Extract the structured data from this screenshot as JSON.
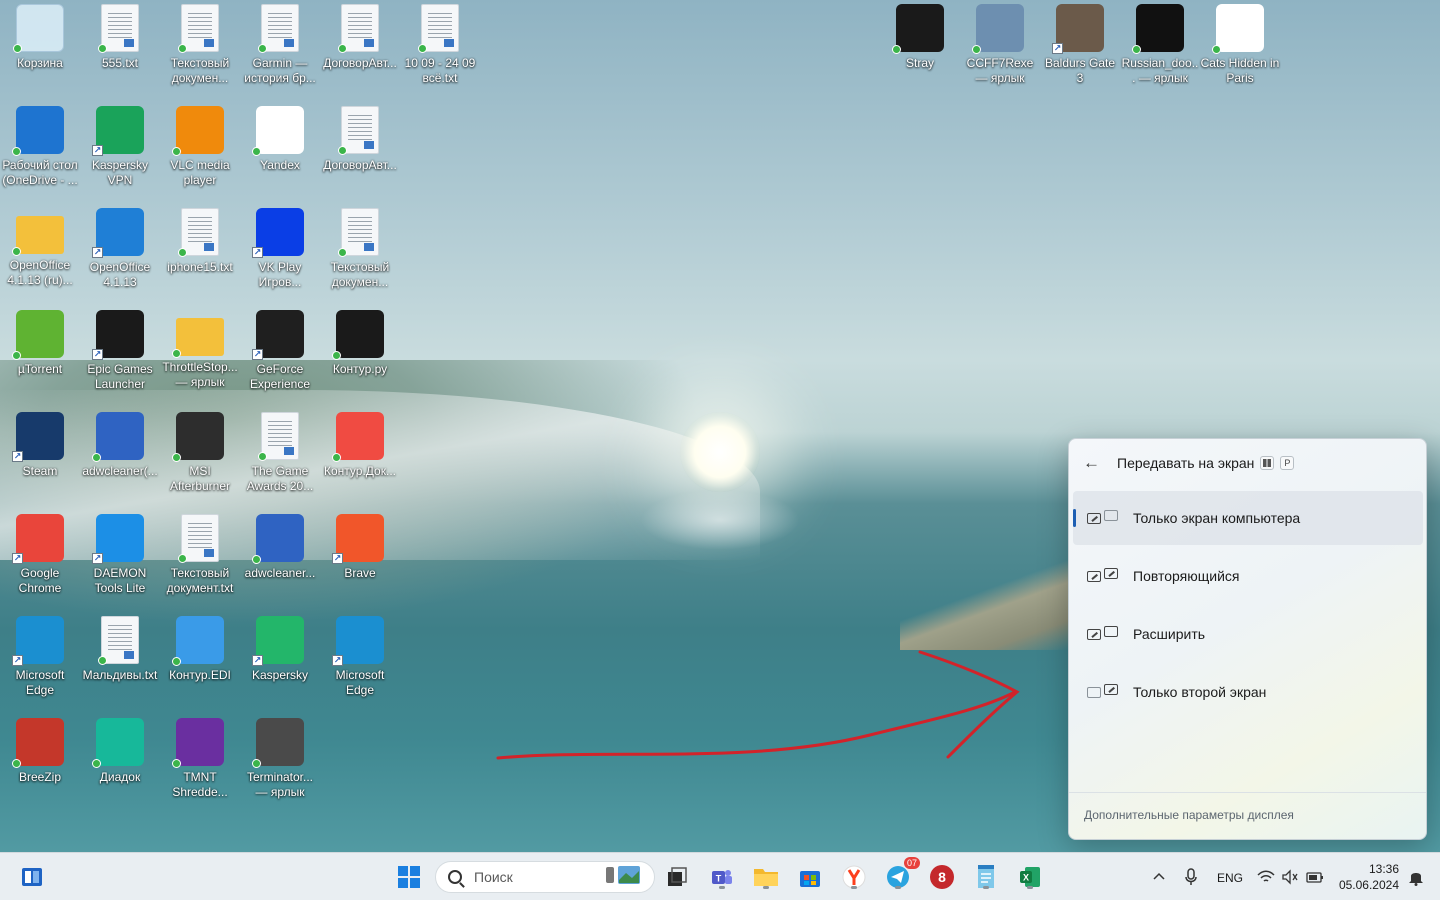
{
  "desktop": {
    "icons": [
      {
        "label": "Корзина",
        "icon": "recycle-bin-icon",
        "color": "#cfe6f5"
      },
      {
        "label": "555.txt",
        "icon": "text-file-icon"
      },
      {
        "label": "Текстовый докумен...",
        "icon": "text-file-icon"
      },
      {
        "label": "Garmin — история бр...",
        "icon": "text-file-icon"
      },
      {
        "label": "ДоговорАвт...",
        "icon": "document-icon"
      },
      {
        "label": "10 09 - 24 09 всё.txt",
        "icon": "text-file-icon"
      },
      {
        "label": "Рабочий стол (OneDrive - ...",
        "icon": "onedrive-icon",
        "color": "#1e74d0"
      },
      {
        "label": "Kaspersky VPN",
        "icon": "kaspersky-vpn-icon",
        "color": "#1aa35a"
      },
      {
        "label": "VLC media player",
        "icon": "vlc-icon",
        "color": "#f08a0c"
      },
      {
        "label": "Yandex",
        "icon": "yandex-browser-icon",
        "color": "#ffffff"
      },
      {
        "label": "ДоговорАвт...",
        "icon": "document-icon"
      },
      {
        "label": "OpenOffice 4.1.13 (ru)...",
        "icon": "folder-icon",
        "color": "#f3c03b"
      },
      {
        "label": "OpenOffice 4.1.13",
        "icon": "openoffice-icon",
        "color": "#1f7fd6"
      },
      {
        "label": "iphone15.txt",
        "icon": "text-file-icon"
      },
      {
        "label": "VK Play Игров...",
        "icon": "vk-play-icon",
        "color": "#0a3ee6"
      },
      {
        "label": "Текстовый докумен...",
        "icon": "text-file-icon"
      },
      {
        "label": "µTorrent",
        "icon": "utorrent-icon",
        "color": "#5fb332"
      },
      {
        "label": "Epic Games Launcher",
        "icon": "epic-games-icon",
        "color": "#1a1a1a"
      },
      {
        "label": "ThrottleStop... — ярлык",
        "icon": "folder-icon",
        "color": "#f3c03b"
      },
      {
        "label": "GeForce Experience",
        "icon": "geforce-icon",
        "color": "#1f1f1f"
      },
      {
        "label": "Контур.ру",
        "icon": "kontur-icon",
        "color": "#1a1a1a"
      },
      {
        "label": "Steam",
        "icon": "steam-icon",
        "color": "#173a6b"
      },
      {
        "label": "adwcleaner(...",
        "icon": "adwcleaner-icon",
        "color": "#2f63c2"
      },
      {
        "label": "MSI Afterburner",
        "icon": "msi-afterburner-icon",
        "color": "#2d2d2d"
      },
      {
        "label": "The Game Awards 20...",
        "icon": "text-file-icon"
      },
      {
        "label": "Контур.Док...",
        "icon": "kontur-doc-icon",
        "color": "#f04b42"
      },
      {
        "label": "Google Chrome",
        "icon": "chrome-icon",
        "color": "#e9453b"
      },
      {
        "label": "DAEMON Tools Lite",
        "icon": "daemon-tools-icon",
        "color": "#1c8fe6"
      },
      {
        "label": "Текстовый документ.txt",
        "icon": "text-file-icon"
      },
      {
        "label": "adwcleaner...",
        "icon": "adwcleaner-icon",
        "color": "#2f63c2"
      },
      {
        "label": "Brave",
        "icon": "brave-icon",
        "color": "#f1562a"
      },
      {
        "label": "Microsoft Edge",
        "icon": "edge-icon",
        "color": "#1b8fd0"
      },
      {
        "label": "Мальдивы.txt",
        "icon": "text-file-icon"
      },
      {
        "label": "Контур.EDI",
        "icon": "kontur-edi-icon",
        "color": "#3a9be8"
      },
      {
        "label": "Kaspersky",
        "icon": "kaspersky-icon",
        "color": "#23b66a"
      },
      {
        "label": "Microsoft Edge",
        "icon": "edge-icon",
        "color": "#1b8fd0"
      },
      {
        "label": "BreeZip",
        "icon": "breezip-icon",
        "color": "#c4372a"
      },
      {
        "label": "Диадок",
        "icon": "diadoc-icon",
        "color": "#17b89a"
      },
      {
        "label": "TMNT Shredde...",
        "icon": "tmnt-game-icon",
        "color": "#6a2fa0"
      },
      {
        "label": "Terminator... — ярлык",
        "icon": "terminator-game-icon",
        "color": "#4a4a4a"
      },
      {
        "label": "Stray",
        "icon": "stray-game-icon",
        "color": "#1a1a1a"
      },
      {
        "label": "CCFF7Rexe — ярлык",
        "icon": "ff7-game-icon",
        "color": "#6d8fb0"
      },
      {
        "label": "Baldurs Gate 3",
        "icon": "baldurs-gate-icon",
        "color": "#6b5a4a"
      },
      {
        "label": "Russian_doo... — ярлык",
        "icon": "unreal-engine-icon",
        "color": "#111111"
      },
      {
        "label": "Cats Hidden in Paris",
        "icon": "cats-hidden-icon",
        "color": "#ffffff"
      }
    ]
  },
  "project_panel": {
    "title": "Передавать на экран",
    "key_win": "⊞",
    "key_p": "P",
    "options": [
      {
        "label": "Только экран компьютера",
        "selected": true
      },
      {
        "label": "Повторяющийся",
        "selected": false
      },
      {
        "label": "Расширить",
        "selected": false
      },
      {
        "label": "Только второй экран",
        "selected": false
      }
    ],
    "footer": "Дополнительные параметры дисплея"
  },
  "taskbar": {
    "search_placeholder": "Поиск",
    "apps": [
      {
        "name": "start-icon"
      },
      {
        "name": "task-view-icon"
      },
      {
        "name": "teams-icon"
      },
      {
        "name": "file-explorer-icon"
      },
      {
        "name": "microsoft-store-icon"
      },
      {
        "name": "yandex-taskbar-icon"
      },
      {
        "name": "telegram-icon",
        "badge": "07"
      },
      {
        "name": "app-8-icon"
      },
      {
        "name": "notepad-icon"
      },
      {
        "name": "excel-icon"
      }
    ],
    "language": "ENG",
    "time": "13:36",
    "date": "05.06.2024"
  },
  "colors": {
    "accent": "#1d5fb3",
    "annotation_arrow": "#d2232a"
  }
}
